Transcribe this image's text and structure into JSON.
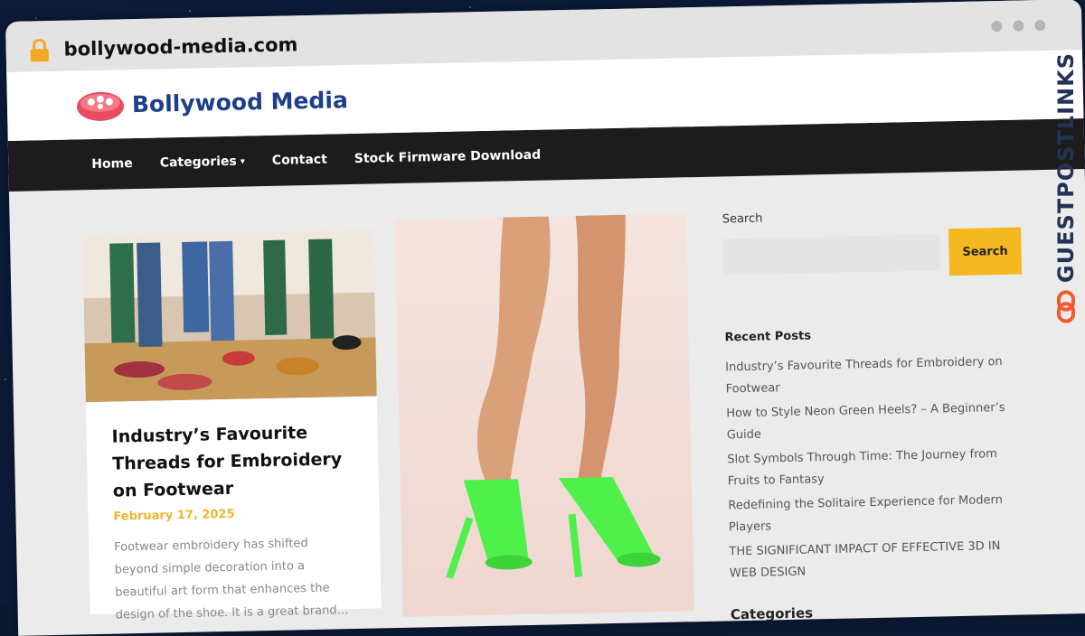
{
  "browser": {
    "url": "bollywood-media.com"
  },
  "site": {
    "name": "Bollywood Media"
  },
  "nav": {
    "items": [
      "Home",
      "Categories",
      "Contact",
      "Stock Firmware Download"
    ]
  },
  "post": {
    "title": "Industry’s Favourite Threads for Embroidery on Footwear",
    "date": "February 17, 2025",
    "excerpt": "Footwear embroidery has shifted beyond simple decoration into a beautiful art form that enhances the design of the shoe. It is a great brand…"
  },
  "sidebar": {
    "search_label": "Search",
    "search_button": "Search",
    "recent_title": "Recent Posts",
    "recent_posts": [
      "Industry’s Favourite Threads for Embroidery on Footwear",
      "How to Style Neon Green Heels? – A Beginner’s Guide",
      "Slot Symbols Through Time: The Journey from Fruits to Fantasy",
      "Redefining the Solitaire Experience for Modern Players",
      "THE SIGNIFICANT IMPACT OF EFFECTIVE 3D IN WEB DESIGN"
    ],
    "categories_title": "Categories"
  },
  "watermark": {
    "text": "GUESTPOSTLINKS"
  },
  "colors": {
    "accent": "#f4b920",
    "nav_bg": "#1c1c1c",
    "brand": "#1e3e8c",
    "date": "#f0b429"
  }
}
